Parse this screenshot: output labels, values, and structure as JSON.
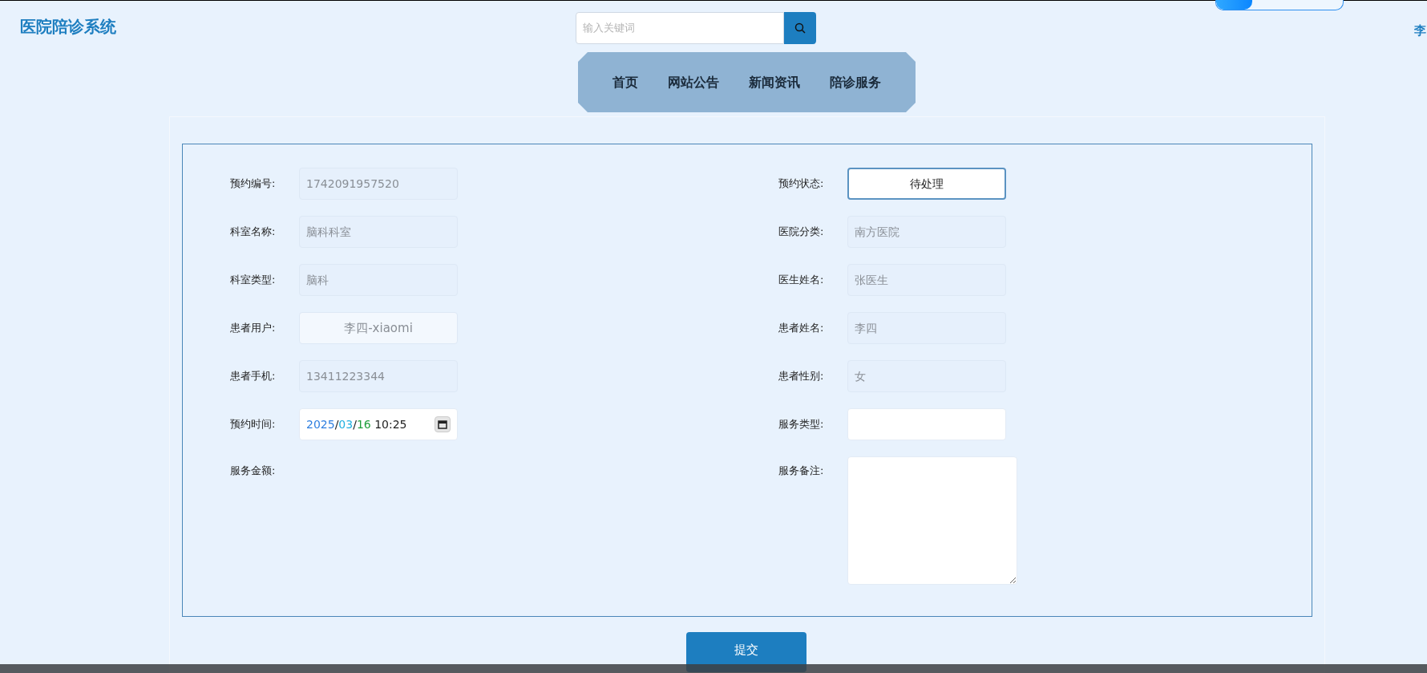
{
  "header": {
    "title": "医院陪诊系统",
    "search": {
      "placeholder": "输入关键词"
    },
    "user_name": "李"
  },
  "nav": {
    "items": [
      {
        "label": "首页"
      },
      {
        "label": "网站公告"
      },
      {
        "label": "新闻资讯"
      },
      {
        "label": "陪诊服务"
      }
    ]
  },
  "form": {
    "left": [
      {
        "label": "预约编号:",
        "kind": "readonly",
        "value": "1742091957520"
      },
      {
        "label": "科室名称:",
        "kind": "readonly",
        "value": "脑科科室"
      },
      {
        "label": "科室类型:",
        "kind": "readonly",
        "value": "脑科"
      },
      {
        "label": "患者用户:",
        "kind": "select",
        "value": "李四-xiaomi"
      },
      {
        "label": "患者手机:",
        "kind": "readonly",
        "value": "13411223344"
      },
      {
        "label": "预约时间:",
        "kind": "datetime",
        "parts": [
          {
            "text": "2025",
            "color": "#2f7fe0"
          },
          {
            "text": "/"
          },
          {
            "text": "03",
            "color": "#1fb0e0"
          },
          {
            "text": "/"
          },
          {
            "text": "16",
            "color": "#1e9e3a"
          },
          {
            "text": " 10:25"
          }
        ]
      },
      {
        "label": "服务金额:",
        "kind": "none"
      }
    ],
    "right": [
      {
        "label": "预约状态:",
        "kind": "status",
        "value": "待处理"
      },
      {
        "label": "医院分类:",
        "kind": "readonly",
        "value": "南方医院"
      },
      {
        "label": "医生姓名:",
        "kind": "readonly",
        "value": "张医生"
      },
      {
        "label": "患者姓名:",
        "kind": "readonly",
        "value": "李四"
      },
      {
        "label": "患者性别:",
        "kind": "readonly",
        "value": "女"
      },
      {
        "label": "服务类型:",
        "kind": "text"
      },
      {
        "label": "服务备注:",
        "kind": "textarea"
      }
    ]
  },
  "submit": "提交"
}
